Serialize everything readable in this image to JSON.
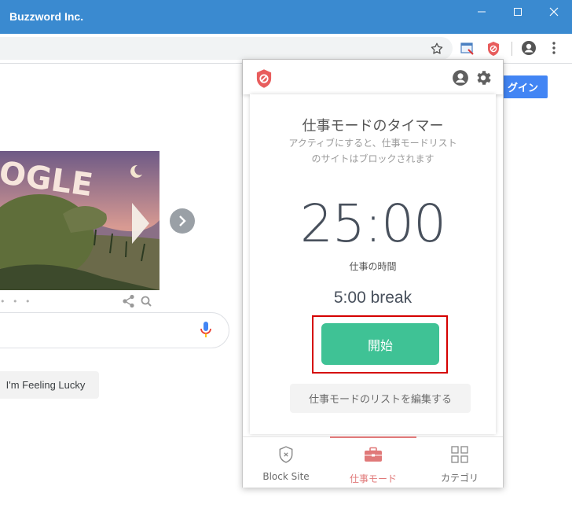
{
  "window": {
    "title": "Buzzword Inc."
  },
  "google": {
    "login_label": "グイン",
    "lucky_label": "I'm Feeling Lucky",
    "doodle_text": "OGLE",
    "dots": "• • •"
  },
  "popup": {
    "title": "仕事モードのタイマー",
    "description": "アクティブにすると、仕事モードリストのサイトはブロックされます",
    "timer": "25:00",
    "work_label": "仕事の時間",
    "break_text": "5:00 break",
    "start_label": "開始",
    "edit_label": "仕事モードのリストを編集する",
    "tabs": [
      {
        "label": "Block Site",
        "icon": "shield-x-icon",
        "active": false
      },
      {
        "label": "仕事モード",
        "icon": "briefcase-icon",
        "active": true
      },
      {
        "label": "カテゴリ",
        "icon": "grid-icon",
        "active": false
      }
    ]
  },
  "colors": {
    "titlebar": "#3a8ad0",
    "start": "#3fc295",
    "accent": "#e07979",
    "highlight": "#d50000"
  }
}
